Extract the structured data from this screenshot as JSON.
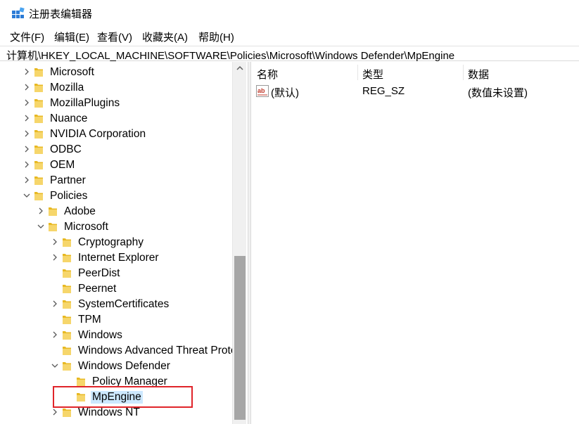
{
  "window": {
    "title": "注册表编辑器",
    "icon": "regedit-icon"
  },
  "menu": [
    "文件(F)",
    "编辑(E)",
    "查看(V)",
    "收藏夹(A)",
    "帮助(H)"
  ],
  "address": "计算机\\HKEY_LOCAL_MACHINE\\SOFTWARE\\Policies\\Microsoft\\Windows Defender\\MpEngine",
  "tree": [
    {
      "label": "Microsoft",
      "expander": "collapsed"
    },
    {
      "label": "Mozilla",
      "expander": "collapsed"
    },
    {
      "label": "MozillaPlugins",
      "expander": "collapsed"
    },
    {
      "label": "Nuance",
      "expander": "collapsed"
    },
    {
      "label": "NVIDIA Corporation",
      "expander": "collapsed"
    },
    {
      "label": "ODBC",
      "expander": "collapsed"
    },
    {
      "label": "OEM",
      "expander": "collapsed"
    },
    {
      "label": "Partner",
      "expander": "collapsed"
    },
    {
      "label": "Policies",
      "expander": "expanded"
    },
    {
      "label": "Adobe",
      "expander": "collapsed"
    },
    {
      "label": "Microsoft",
      "expander": "expanded"
    },
    {
      "label": "Cryptography",
      "expander": "collapsed"
    },
    {
      "label": "Internet Explorer",
      "expander": "collapsed"
    },
    {
      "label": "PeerDist",
      "expander": "none"
    },
    {
      "label": "Peernet",
      "expander": "none"
    },
    {
      "label": "SystemCertificates",
      "expander": "collapsed"
    },
    {
      "label": "TPM",
      "expander": "none"
    },
    {
      "label": "Windows",
      "expander": "collapsed"
    },
    {
      "label": "Windows Advanced Threat Protection",
      "expander": "none"
    },
    {
      "label": "Windows Defender",
      "expander": "expanded"
    },
    {
      "label": "Policy Manager",
      "expander": "none"
    },
    {
      "label": "MpEngine",
      "expander": "none",
      "selected": true
    },
    {
      "label": "Windows NT",
      "expander": "collapsed"
    }
  ],
  "values": {
    "headers": {
      "name": "名称",
      "type": "类型",
      "data": "数据"
    },
    "rows": [
      {
        "icon": "string-value-icon",
        "name": "(默认)",
        "type": "REG_SZ",
        "data": "(数值未设置)"
      }
    ]
  },
  "colors": {
    "highlight": "#e0242a",
    "folder": "#e8b923",
    "selection": "#cce8ff"
  }
}
